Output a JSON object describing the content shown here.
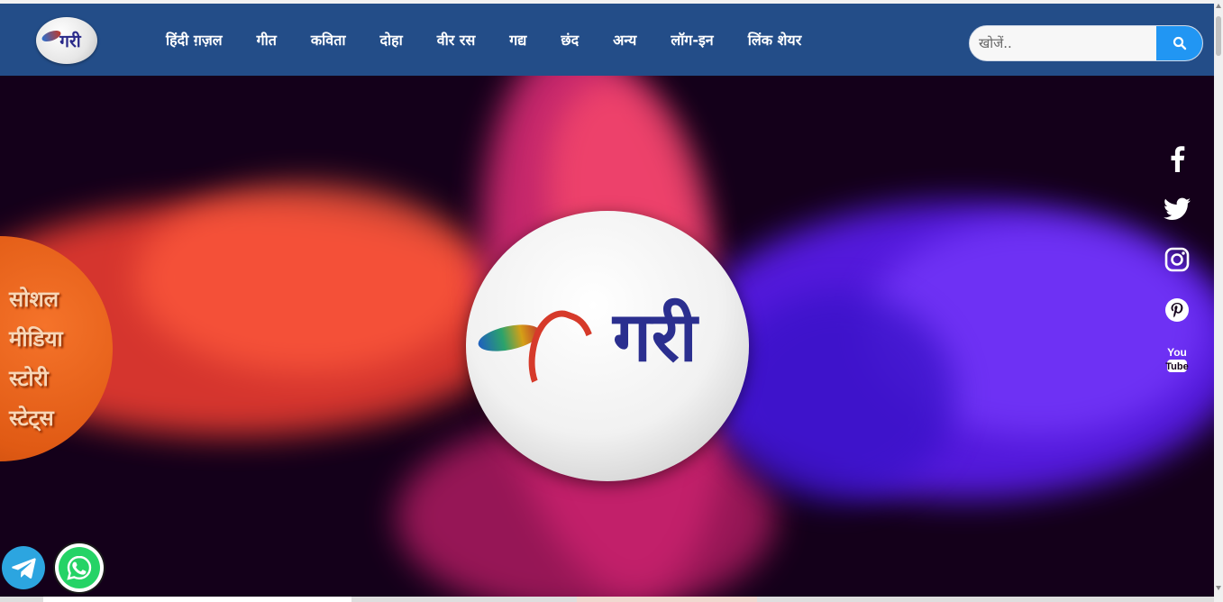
{
  "site": {
    "logo_name": "logo",
    "logo_text": "गरी"
  },
  "nav": {
    "items": [
      {
        "label": "हिंदी ग़ज़ल"
      },
      {
        "label": "गीत"
      },
      {
        "label": "कविता"
      },
      {
        "label": "दोहा"
      },
      {
        "label": "वीर रस"
      },
      {
        "label": "गद्य"
      },
      {
        "label": "छंद"
      },
      {
        "label": "अन्य"
      },
      {
        "label": "लॉग-इन"
      },
      {
        "label": "लिंक शेयर"
      }
    ]
  },
  "search": {
    "placeholder": "खोजें..",
    "icon": "search-icon"
  },
  "hero": {
    "logo_text": "गरी"
  },
  "social_badge": {
    "lines": [
      "सोशल",
      "मीडिया",
      "स्टोरी",
      "स्टेट्स"
    ]
  },
  "social_icons": [
    {
      "name": "facebook-icon"
    },
    {
      "name": "twitter-icon"
    },
    {
      "name": "instagram-icon"
    },
    {
      "name": "pinterest-icon"
    },
    {
      "name": "youtube-icon",
      "text_top": "You",
      "text_bottom": "Tube"
    }
  ],
  "floating": {
    "telegram": "telegram-icon",
    "whatsapp": "whatsapp-icon"
  },
  "colors": {
    "navbar": "#234d88",
    "search_button": "#2196f3",
    "badge": "#e05a14",
    "telegram": "#2ca5e0",
    "whatsapp": "#25d366"
  }
}
